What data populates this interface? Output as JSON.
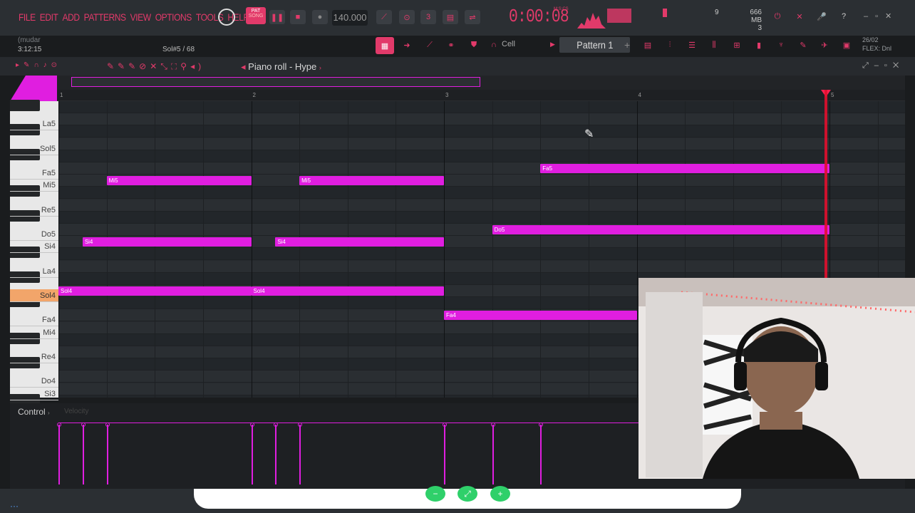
{
  "menu": [
    "FILE",
    "EDIT",
    "ADD",
    "PATTERNS",
    "VIEW",
    "OPTIONS",
    "TOOLS",
    "HELP"
  ],
  "transport": {
    "pat_label": "PAT",
    "song_label": "SONG",
    "bpm": "140.000",
    "time": "0:00:08",
    "time_unit": "M:S:CS",
    "memory": "666 MB",
    "memory_sub": "3",
    "cpu": "9"
  },
  "song": {
    "name": "(mudar",
    "position": "3:12:15",
    "hint": "Sol#5 / 68"
  },
  "pattern": {
    "label": "Pattern 1",
    "snap": "Cell"
  },
  "flex": {
    "line1": "26/02",
    "line2": "FLEX: Dnl"
  },
  "piano_roll": {
    "title": "Piano roll - Hype",
    "bars": [
      "1",
      "2",
      "3",
      "4",
      "5"
    ],
    "keys": [
      {
        "label": "La5",
        "row": 1
      },
      {
        "label": "Sol5",
        "row": 3
      },
      {
        "label": "Fa5",
        "row": 5
      },
      {
        "label": "Mi5",
        "row": 6
      },
      {
        "label": "Re5",
        "row": 8
      },
      {
        "label": "Do5",
        "row": 10
      },
      {
        "label": "Si4",
        "row": 11
      },
      {
        "label": "La4",
        "row": 13
      },
      {
        "label": "Sol4",
        "row": 15,
        "active": true
      },
      {
        "label": "Fa4",
        "row": 17
      },
      {
        "label": "Mi4",
        "row": 18
      },
      {
        "label": "Re4",
        "row": 20
      },
      {
        "label": "Do4",
        "row": 22
      },
      {
        "label": "Si3",
        "row": 23
      }
    ],
    "notes": [
      {
        "label": "Mi5",
        "start": 0.25,
        "len": 0.75,
        "row": 6
      },
      {
        "label": "Mi5",
        "start": 1.25,
        "len": 0.75,
        "row": 6
      },
      {
        "label": "Fa5",
        "start": 2.5,
        "len": 1.5,
        "row": 5
      },
      {
        "label": "Do5",
        "start": 2.25,
        "len": 1.75,
        "row": 10
      },
      {
        "label": "Si4",
        "start": 0.125,
        "len": 0.875,
        "row": 11
      },
      {
        "label": "Si4",
        "start": 1.125,
        "len": 0.875,
        "row": 11
      },
      {
        "label": "Sol4",
        "start": 0,
        "len": 1,
        "row": 15
      },
      {
        "label": "Sol4",
        "start": 1,
        "len": 1,
        "row": 15
      },
      {
        "label": "Fa4",
        "start": 2,
        "len": 1,
        "row": 17
      }
    ]
  },
  "control": {
    "label": "Control",
    "target": "Velocity",
    "velocities": [
      0,
      0.125,
      0.25,
      1,
      1.125,
      1.25,
      2,
      2.25,
      2.5
    ]
  },
  "colors": {
    "accent": "#e23a6a",
    "note": "#e01ee0",
    "playhead": "#e0102e",
    "zoom": "#2fd06a"
  },
  "icons": {
    "zoom_out": "zoom-out-icon",
    "zoom_fit": "zoom-fit-icon",
    "zoom_in": "zoom-in-icon"
  }
}
